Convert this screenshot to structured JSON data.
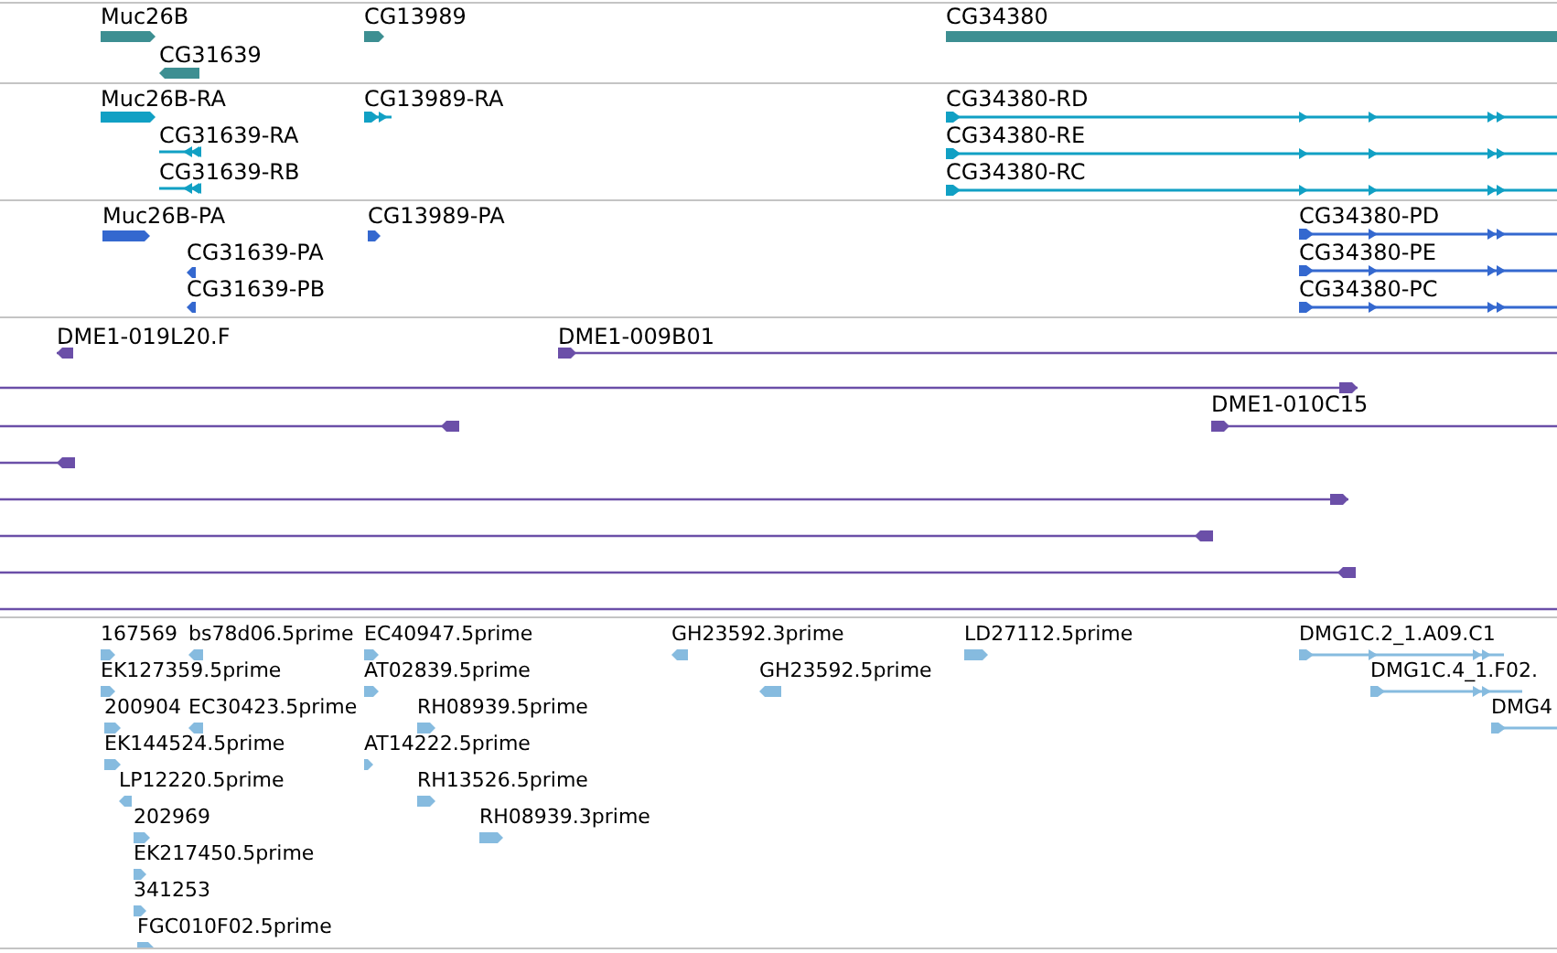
{
  "tracks": [
    {
      "color": "#3d8f92",
      "features": [
        {
          "label": "Muc26B",
          "kind": "fwd"
        },
        {
          "label": "CG13989",
          "kind": "fwd"
        },
        {
          "label": "CG34380",
          "kind": "bar"
        },
        {
          "label": "CG31639",
          "kind": "rev"
        }
      ]
    },
    {
      "color": "#11a0c4",
      "features": [
        {
          "label": "Muc26B-RA",
          "kind": "fwd"
        },
        {
          "label": "CG13989-RA",
          "kind": "fwdline"
        },
        {
          "label": "CG34380-RD",
          "kind": "fwdline"
        },
        {
          "label": "CG31639-RA",
          "kind": "revline"
        },
        {
          "label": "CG34380-RE",
          "kind": "fwdline"
        },
        {
          "label": "CG31639-RB",
          "kind": "revline"
        },
        {
          "label": "CG34380-RC",
          "kind": "fwdline"
        }
      ]
    },
    {
      "color": "#3468cf",
      "features": [
        {
          "label": "Muc26B-PA",
          "kind": "fwd"
        },
        {
          "label": "CG13989-PA",
          "kind": "fwd"
        },
        {
          "label": "CG34380-PD",
          "kind": "fwdline"
        },
        {
          "label": "CG31639-PA",
          "kind": "rev"
        },
        {
          "label": "CG34380-PE",
          "kind": "fwdline"
        },
        {
          "label": "CG31639-PB",
          "kind": "rev"
        },
        {
          "label": "CG34380-PC",
          "kind": "fwdline"
        }
      ]
    },
    {
      "color": "#6b4fa8",
      "features": [
        {
          "label": "DME1-019L20.F",
          "kind": "revread"
        },
        {
          "label": "DME1-009B01",
          "kind": "fwdread"
        },
        {
          "kind": "fwdread"
        },
        {
          "kind": "revread"
        },
        {
          "label": "DME1-010C15",
          "kind": "fwdread"
        },
        {
          "kind": "revread"
        },
        {
          "kind": "fwdread"
        },
        {
          "kind": "revread"
        },
        {
          "kind": "revread"
        },
        {
          "kind": "read"
        }
      ]
    },
    {
      "color": "#86bbdf",
      "features": [
        {
          "label": "167569",
          "kind": "fwd"
        },
        {
          "label": "bs78d06.5prime",
          "kind": "rev"
        },
        {
          "label": "EC40947.5prime",
          "kind": "fwd"
        },
        {
          "label": "GH23592.3prime",
          "kind": "rev"
        },
        {
          "label": "LD27112.5prime",
          "kind": "fwd"
        },
        {
          "label": "DMG1C.2_1.A09.C1",
          "kind": "fwdline"
        },
        {
          "label": "EK127359.5prime",
          "kind": "fwd"
        },
        {
          "label": "AT02839.5prime",
          "kind": "fwd"
        },
        {
          "label": "GH23592.5prime",
          "kind": "rev"
        },
        {
          "label": "DMG1C.4_1.F02.",
          "kind": "fwdline"
        },
        {
          "label": "200904",
          "kind": "fwd"
        },
        {
          "label": "EC30423.5prime",
          "kind": "rev"
        },
        {
          "label": "RH08939.5prime",
          "kind": "fwd"
        },
        {
          "label": "DMG4",
          "kind": "fwdline"
        },
        {
          "label": "EK144524.5prime",
          "kind": "fwd"
        },
        {
          "label": "AT14222.5prime",
          "kind": "fwd"
        },
        {
          "label": "LP12220.5prime",
          "kind": "rev"
        },
        {
          "label": "RH13526.5prime",
          "kind": "fwd"
        },
        {
          "label": "202969",
          "kind": "fwd"
        },
        {
          "label": "RH08939.3prime",
          "kind": "fwd"
        },
        {
          "label": "EK217450.5prime",
          "kind": "fwd"
        },
        {
          "label": "341253",
          "kind": "fwd"
        },
        {
          "label": "FGC010F02.5prime",
          "kind": "fwd"
        }
      ]
    }
  ]
}
